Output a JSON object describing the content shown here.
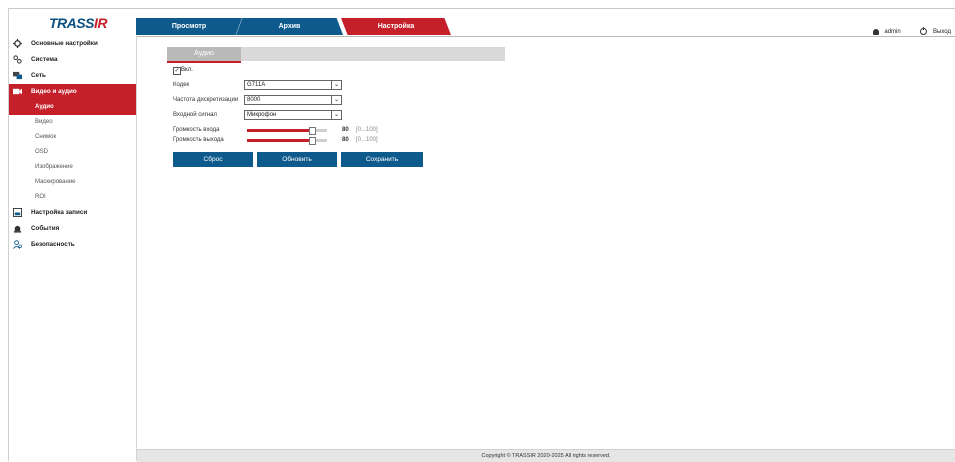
{
  "brand": {
    "logo_main": "TRASS",
    "logo_accent": "IR"
  },
  "tabs": [
    {
      "label": "Просмотр"
    },
    {
      "label": "Архив"
    },
    {
      "label": "Настройка"
    }
  ],
  "header": {
    "user": "admin",
    "logout": "Выход"
  },
  "sidebar": {
    "items": [
      {
        "label": "Основные настройки",
        "icon": "gear-icon"
      },
      {
        "label": "Система",
        "icon": "settings-icon"
      },
      {
        "label": "Сеть",
        "icon": "network-icon"
      },
      {
        "label": "Видео и аудио",
        "icon": "video-icon"
      },
      {
        "label": "Настройка записи",
        "icon": "record-icon"
      },
      {
        "label": "События",
        "icon": "events-icon"
      },
      {
        "label": "Безопасность",
        "icon": "security-icon"
      }
    ],
    "subitems": [
      {
        "label": "Аудио"
      },
      {
        "label": "Видео"
      },
      {
        "label": "Снимок"
      },
      {
        "label": "OSD"
      },
      {
        "label": "Изображение"
      },
      {
        "label": "Маскирование"
      },
      {
        "label": "ROI"
      }
    ]
  },
  "audio": {
    "tab": "Аудио",
    "enable_label": "Вкл.",
    "codec_label": "Кодек",
    "codec_value": "G711A",
    "rate_label": "Частота дискретизации",
    "rate_value": "8000",
    "input_label": "Входной сигнал",
    "input_value": "Микрофон",
    "in_volume_label": "Громкость входа",
    "in_volume_value": "80",
    "out_volume_label": "Громкость выхода",
    "out_volume_value": "80",
    "range_text": "[0...100]",
    "buttons": {
      "reset": "Сброс",
      "refresh": "Обновить",
      "save": "Сохранить"
    }
  },
  "footer": "Copyright © TRASSIR 2020-2025 All rights reserved.",
  "colors": {
    "accent": "#c51f2a",
    "primary": "#0e5a8c"
  }
}
